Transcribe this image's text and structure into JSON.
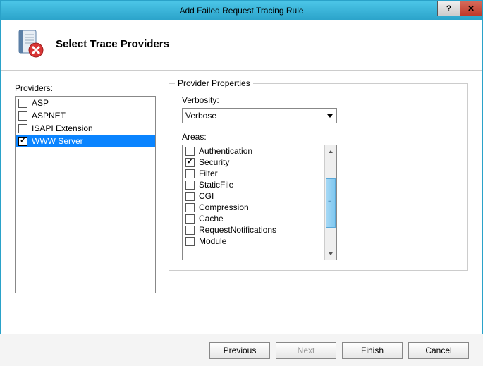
{
  "window": {
    "title": "Add Failed Request Tracing Rule"
  },
  "header": {
    "title": "Select Trace Providers"
  },
  "providers": {
    "label": "Providers:",
    "items": [
      {
        "label": "ASP",
        "checked": false,
        "selected": false
      },
      {
        "label": "ASPNET",
        "checked": false,
        "selected": false
      },
      {
        "label": "ISAPI Extension",
        "checked": false,
        "selected": false
      },
      {
        "label": "WWW Server",
        "checked": true,
        "selected": true
      }
    ]
  },
  "properties": {
    "group_title": "Provider Properties",
    "verbosity_label": "Verbosity:",
    "verbosity_value": "Verbose",
    "areas_label": "Areas:",
    "areas": [
      {
        "label": "Authentication",
        "checked": false
      },
      {
        "label": "Security",
        "checked": true
      },
      {
        "label": "Filter",
        "checked": false
      },
      {
        "label": "StaticFile",
        "checked": false
      },
      {
        "label": "CGI",
        "checked": false
      },
      {
        "label": "Compression",
        "checked": false
      },
      {
        "label": "Cache",
        "checked": false
      },
      {
        "label": "RequestNotifications",
        "checked": false
      },
      {
        "label": "Module",
        "checked": false
      }
    ]
  },
  "buttons": {
    "previous": "Previous",
    "next": "Next",
    "finish": "Finish",
    "cancel": "Cancel"
  }
}
